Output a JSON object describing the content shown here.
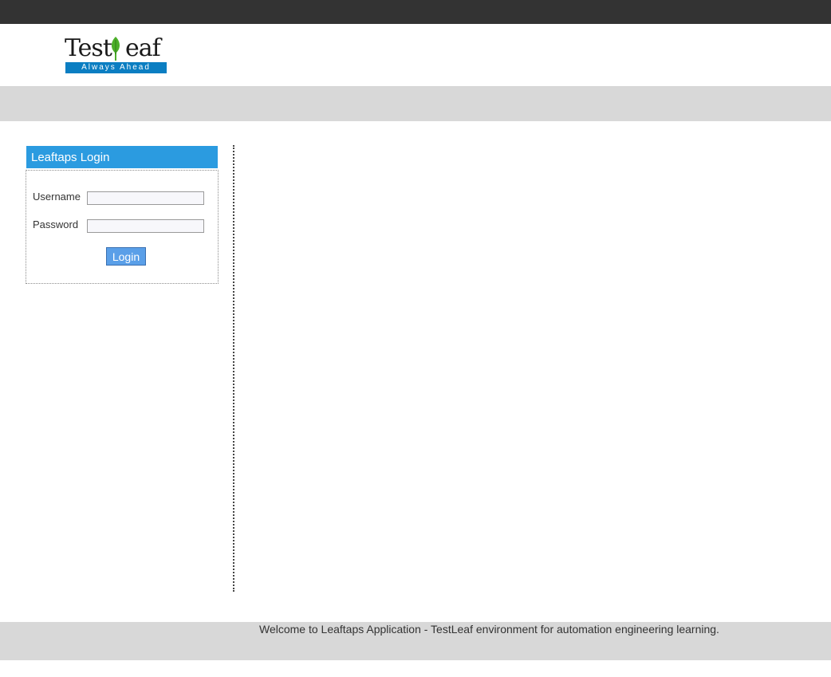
{
  "logo": {
    "brand_text": "TestLeaf",
    "tagline": "Always Ahead",
    "brand_color": "#0b7ec2",
    "leaf_color": "#4caf2a"
  },
  "login": {
    "title": "Leaftaps Login",
    "username_label": "Username",
    "username_value": "",
    "password_label": "Password",
    "password_value": "",
    "button_label": "Login",
    "header_color": "#2b9be0"
  },
  "footer": {
    "text": "Welcome to Leaftaps Application - TestLeaf environment for automation engineering learning."
  }
}
